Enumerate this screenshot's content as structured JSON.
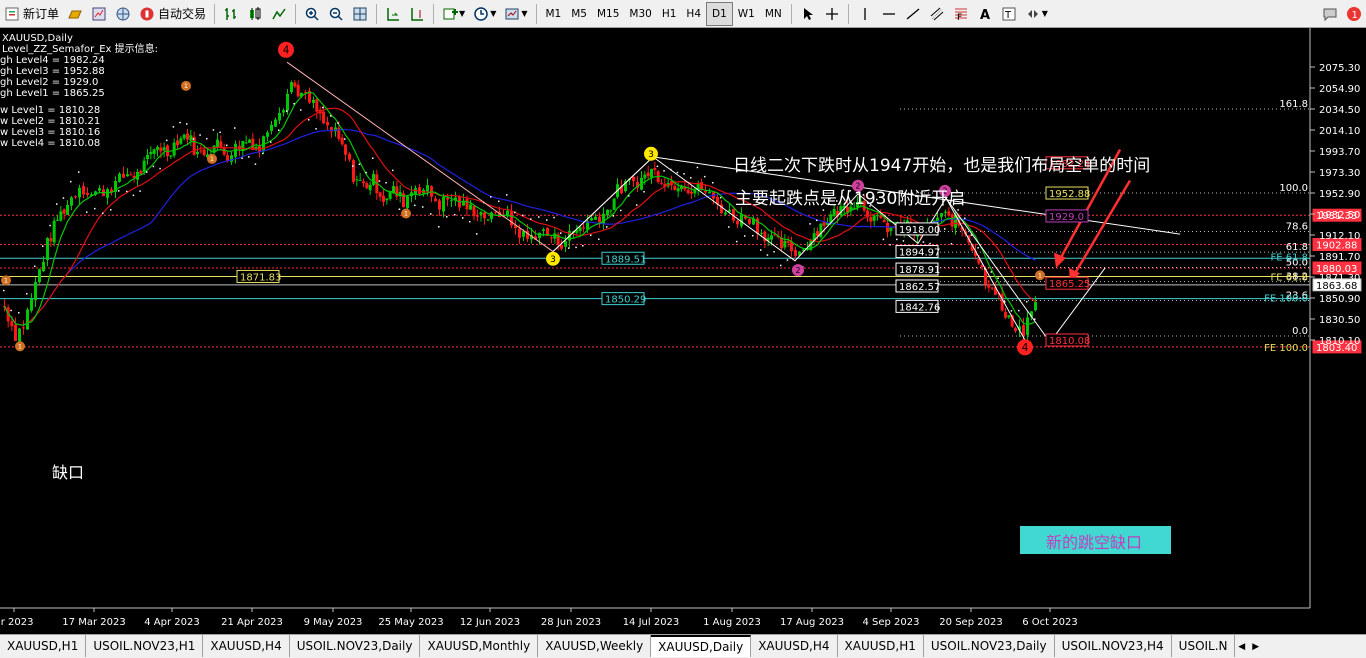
{
  "toolbar": {
    "new_order_label": "新订单",
    "auto_trading_label": "自动交易",
    "timeframes": [
      "M1",
      "M5",
      "M15",
      "M30",
      "H1",
      "H4",
      "D1",
      "W1",
      "MN"
    ],
    "active_timeframe": "D1"
  },
  "chart": {
    "symbol_title": "XAUUSD,Daily",
    "indicator_title": "Level_ZZ_Semafor_Ex 提示信息:",
    "high_levels": [
      "gh Level4 = 1982.24",
      "gh Level3 = 1952.88",
      "gh Level2 = 1929.0",
      "gh Level1 = 1865.25"
    ],
    "low_levels": [
      "w Level1 = 1810.28",
      "w Level2 = 1810.21",
      "w Level3 = 1810.16",
      "w Level4 = 1810.08"
    ],
    "annotation_line1": "日线二次下跌时从1947开始，也是我们布局空单的时间",
    "annotation_line2": "主要起跌点是从1930附近开启",
    "gap_label": "缺口",
    "new_gap_label": "新的跳空缺口",
    "price_axis": [
      "2075.30",
      "2054.90",
      "2034.50",
      "2014.10",
      "1993.70",
      "1973.30",
      "1952.90",
      "1932.50",
      "1912.10",
      "1891.70",
      "1871.30",
      "1850.90",
      "1830.50",
      "1810.10"
    ],
    "date_axis": [
      "ar 2023",
      "17 Mar 2023",
      "4 Apr 2023",
      "21 Apr 2023",
      "9 May 2023",
      "25 May 2023",
      "12 Jun 2023",
      "28 Jun 2023",
      "14 Jul 2023",
      "1 Aug 2023",
      "17 Aug 2023",
      "4 Sep 2023",
      "20 Sep 2023",
      "6 Oct 2023"
    ],
    "fib_labels": [
      "161.8",
      "100.0",
      "78.6",
      "61.8",
      "50.0",
      "38.2",
      "23.6",
      "0.0"
    ],
    "fe_labels": [
      "FE 61.8",
      "FE 61.8",
      "FE 100.0",
      "FE 100.0"
    ],
    "price_boxes": [
      "1982.24",
      "1952.88",
      "1931.33",
      "1929.0",
      "1918.00",
      "1902.88",
      "1894.97",
      "1889.51",
      "1880.03",
      "1878.91",
      "1871.83",
      "1865.25",
      "1863.68",
      "1862.57",
      "1850.29",
      "1842.76",
      "1810.08",
      "1803.40"
    ],
    "semafor_labels": [
      "4",
      "1",
      "1",
      "1",
      "3",
      "3",
      "2",
      "2",
      "2",
      "1",
      "1",
      "1",
      "4"
    ]
  },
  "tabs": [
    "XAUUSD,H1",
    "USOIL.NOV23,H1",
    "XAUUSD,H4",
    "USOIL.NOV23,Daily",
    "XAUUSD,Monthly",
    "XAUUSD,Weekly",
    "XAUUSD,Daily",
    "XAUUSD,H4",
    "XAUUSD,H1",
    "USOIL.NOV23,Daily",
    "USOIL.NOV23,H4",
    "USOIL.N"
  ],
  "active_tab": "XAUUSD,Daily",
  "colors": {
    "bull": "#00c800",
    "bear": "#ff1a1a",
    "ma_fast": "#00c800",
    "ma_mid": "#e01010",
    "ma_slow": "#2020e0",
    "axis_bg": "#000000"
  }
}
